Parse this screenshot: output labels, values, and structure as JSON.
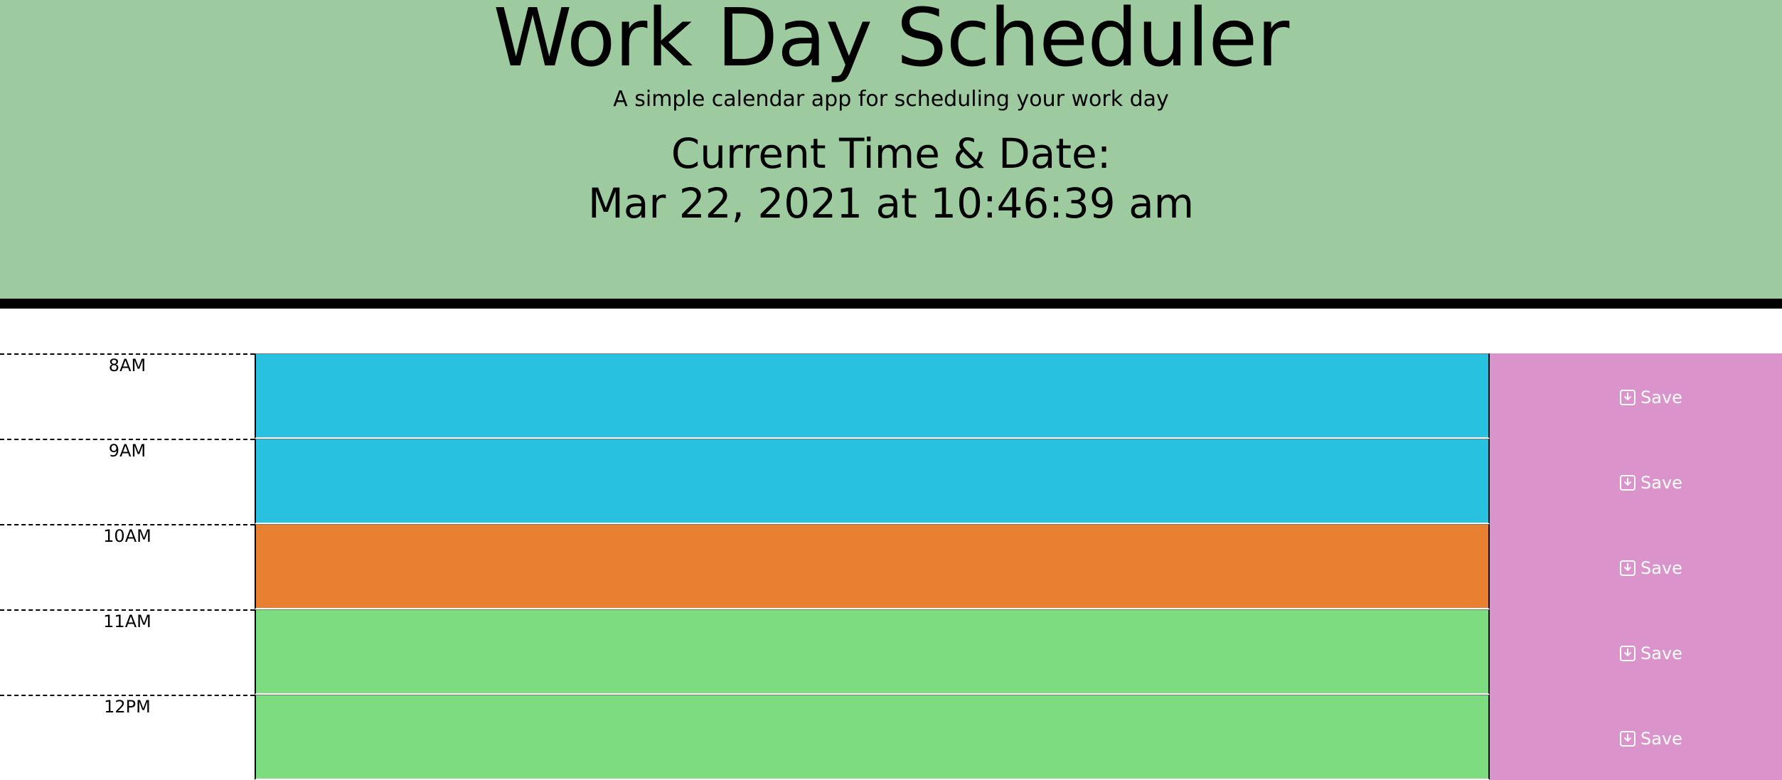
{
  "header": {
    "title": "Work Day Scheduler",
    "subtitle": "A simple calendar app for scheduling your work day",
    "time_label": "Current Time & Date:",
    "time_value": "Mar 22, 2021 at 10:46:39 am"
  },
  "schedule": {
    "rows": [
      {
        "hour": "8AM",
        "status": "past",
        "text": "",
        "save_label": "Save",
        "save_icon": "save-icon"
      },
      {
        "hour": "9AM",
        "status": "past",
        "text": "",
        "save_label": "Save",
        "save_icon": "save-icon"
      },
      {
        "hour": "10AM",
        "status": "present",
        "text": "",
        "save_label": "Save",
        "save_icon": "save-icon"
      },
      {
        "hour": "11AM",
        "status": "future",
        "text": "",
        "save_label": "Save",
        "save_icon": "save-icon"
      },
      {
        "hour": "12PM",
        "status": "future",
        "text": "",
        "save_label": "Save",
        "save_icon": "save-icon"
      }
    ]
  },
  "colors": {
    "header_bg": "#9dcb9f",
    "past": "#29c1e0",
    "present": "#e88031",
    "future": "#7ddc80",
    "save_bg": "#db93cc"
  }
}
